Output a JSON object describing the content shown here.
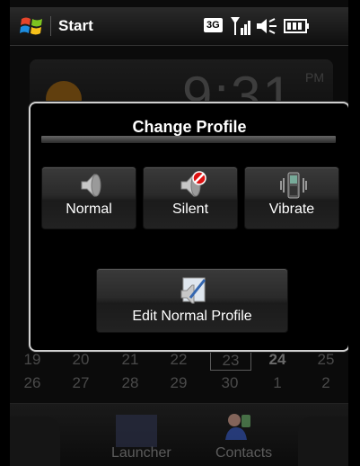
{
  "status_bar": {
    "start_label": "Start",
    "network_label": "3G",
    "icons": [
      "windows-start-icon",
      "signal-icon",
      "speaker-icon",
      "battery-icon"
    ]
  },
  "background": {
    "clock_time": "9:31",
    "clock_ampm": "PM",
    "calendar_rows": [
      [
        "19",
        "20",
        "21",
        "22",
        "23",
        "24",
        "25"
      ],
      [
        "26",
        "27",
        "28",
        "29",
        "30",
        "1",
        "2"
      ]
    ],
    "calendar_today": "23",
    "calendar_bold": "24",
    "bottom_items": {
      "launcher": "Launcher",
      "contacts": "Contacts"
    }
  },
  "dialog": {
    "title": "Change Profile",
    "profiles": [
      {
        "label": "Normal",
        "icon": "speaker-icon"
      },
      {
        "label": "Silent",
        "icon": "speaker-muted-icon"
      },
      {
        "label": "Vibrate",
        "icon": "phone-vibrate-icon"
      }
    ],
    "edit_label": "Edit Normal Profile",
    "edit_icon": "edit-profile-icon"
  },
  "colors": {
    "accent_orange": "#c9801a",
    "mute_red": "#d11"
  }
}
